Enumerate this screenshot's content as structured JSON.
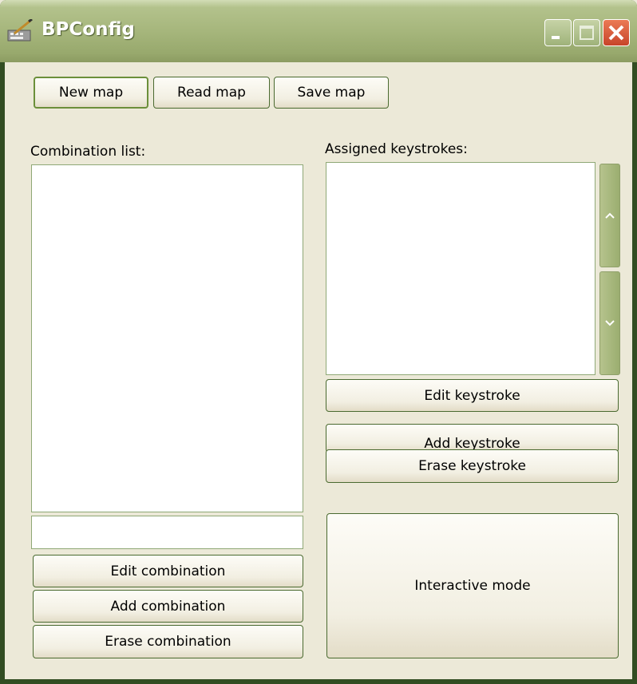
{
  "window": {
    "title": "BPConfig",
    "icon": "bpconfig-app-icon",
    "controls": [
      "minimize-icon",
      "maximize-icon",
      "close-icon"
    ]
  },
  "toolbar": {
    "new_map": "New map",
    "read_map": "Read map",
    "save_map": "Save map"
  },
  "combinations": {
    "label": "Combination list:",
    "items": [],
    "input_value": "",
    "edit": "Edit combination",
    "add": "Add combination",
    "erase": "Erase combination"
  },
  "keystrokes": {
    "label": "Assigned keystrokes:",
    "items": [],
    "edit": "Edit keystroke",
    "add": "Add keystroke",
    "erase": "Erase keystroke"
  },
  "interactive_mode": "Interactive mode",
  "colors": {
    "frame": "#324d22",
    "titlebar": "#a6b67c",
    "client": "#ece9d8",
    "close_button": "#d8553a"
  }
}
